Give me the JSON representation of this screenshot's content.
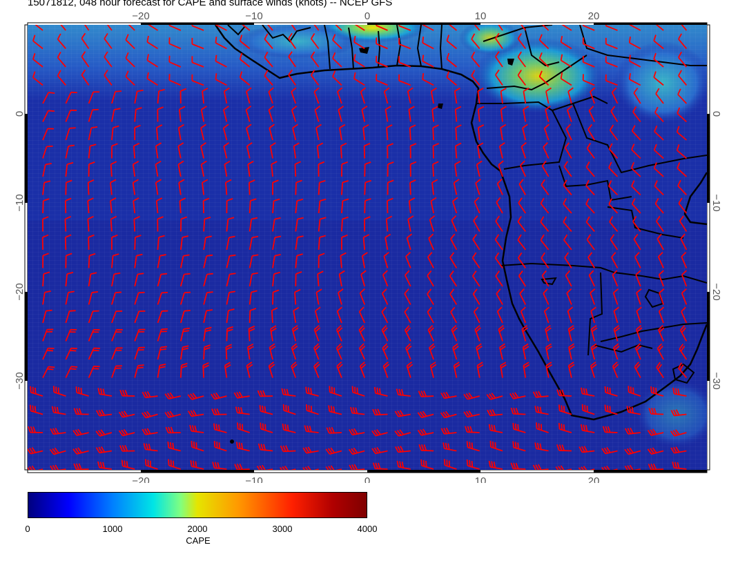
{
  "title": "15071812, 048 hour forecast for CAPE and surface winds (knots) -- NCEP GFS",
  "map": {
    "lon_range": [
      -30,
      30
    ],
    "lat_range": [
      -40,
      10
    ],
    "lon_ticks": [
      {
        "value": -20,
        "label": "−20"
      },
      {
        "value": -10,
        "label": "−10"
      },
      {
        "value": 0,
        "label": "0"
      },
      {
        "value": 10,
        "label": "10"
      },
      {
        "value": 20,
        "label": "20"
      }
    ],
    "lat_ticks": [
      {
        "value": 0,
        "label": "0"
      },
      {
        "value": -10,
        "label": "−10"
      },
      {
        "value": -20,
        "label": "−20"
      },
      {
        "value": -30,
        "label": "−30"
      }
    ],
    "wind_barb_color": "#ff0000",
    "coastline_color": "#000000",
    "ocean_color": "#1a2fa8"
  },
  "colorbar": {
    "min": 0,
    "max": 4000,
    "tick_labels": [
      "0",
      "1000",
      "2000",
      "3000",
      "4000"
    ],
    "tick_values": [
      0,
      1000,
      2000,
      3000,
      4000
    ],
    "label": "CAPE",
    "colors": [
      "#00007f",
      "#0000ff",
      "#0080ff",
      "#00e5e5",
      "#e5e500",
      "#ff9900",
      "#ff0000",
      "#7f0000"
    ]
  }
}
